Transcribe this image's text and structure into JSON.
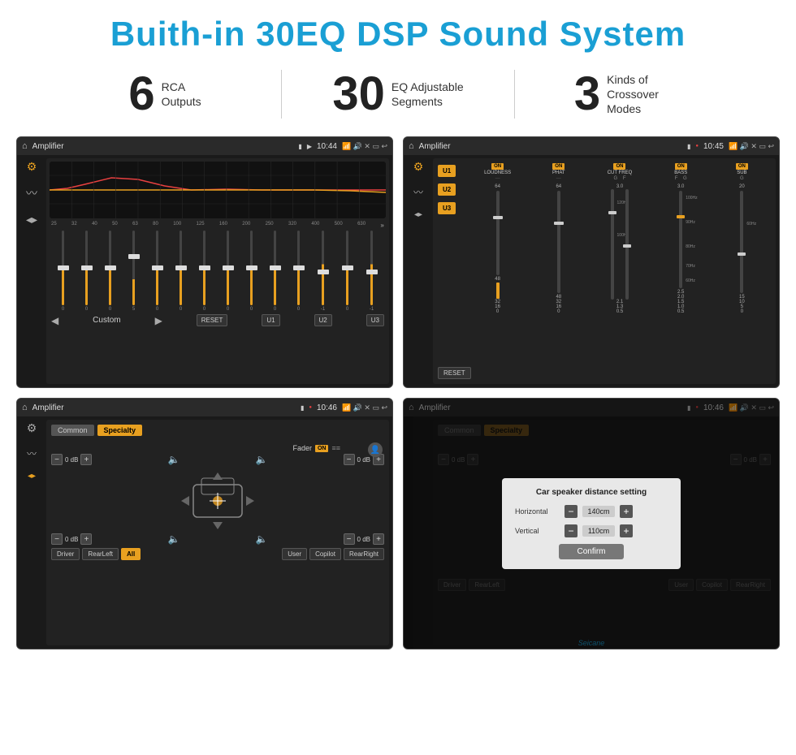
{
  "page": {
    "title": "Buith-in 30EQ DSP Sound System",
    "stats": [
      {
        "number": "6",
        "label": "RCA\nOutputs"
      },
      {
        "number": "30",
        "label": "EQ Adjustable\nSegments"
      },
      {
        "number": "3",
        "label": "Kinds of\nCrossover Modes"
      }
    ]
  },
  "screen1": {
    "title": "Amplifier",
    "time": "10:44",
    "eq_freqs": [
      "25",
      "32",
      "40",
      "50",
      "63",
      "80",
      "100",
      "125",
      "160",
      "200",
      "250",
      "320",
      "400",
      "500",
      "630"
    ],
    "eq_values": [
      "0",
      "0",
      "0",
      "5",
      "0",
      "0",
      "0",
      "0",
      "0",
      "0",
      "0",
      "-1",
      "0",
      "-1"
    ],
    "eq_label": "Custom",
    "buttons": [
      "RESET",
      "U1",
      "U2",
      "U3"
    ]
  },
  "screen2": {
    "title": "Amplifier",
    "time": "10:45",
    "presets": [
      "U1",
      "U2",
      "U3"
    ],
    "controls": [
      "LOUDNESS",
      "PHAT",
      "CUT FREQ",
      "BASS",
      "SUB"
    ],
    "reset_label": "RESET"
  },
  "screen3": {
    "title": "Amplifier",
    "time": "10:46",
    "tabs": [
      "Common",
      "Specialty"
    ],
    "fader_label": "Fader",
    "fader_on": "ON",
    "channels": [
      {
        "label": "0 dB"
      },
      {
        "label": "0 dB"
      },
      {
        "label": "0 dB"
      },
      {
        "label": "0 dB"
      }
    ],
    "zones": [
      "Driver",
      "RearLeft",
      "All",
      "User",
      "Copilot",
      "RearRight"
    ]
  },
  "screen4": {
    "title": "Amplifier",
    "time": "10:46",
    "tabs": [
      "Common",
      "Specialty"
    ],
    "dialog": {
      "title": "Car speaker distance setting",
      "horizontal_label": "Horizontal",
      "horizontal_value": "140cm",
      "vertical_label": "Vertical",
      "vertical_value": "110cm",
      "confirm_label": "Confirm",
      "db_values": [
        "0 dB",
        "0 dB"
      ]
    },
    "zones": [
      "Driver",
      "RearLeft",
      "User",
      "Copilot",
      "RearRight"
    ]
  },
  "seicane": "Seicane"
}
